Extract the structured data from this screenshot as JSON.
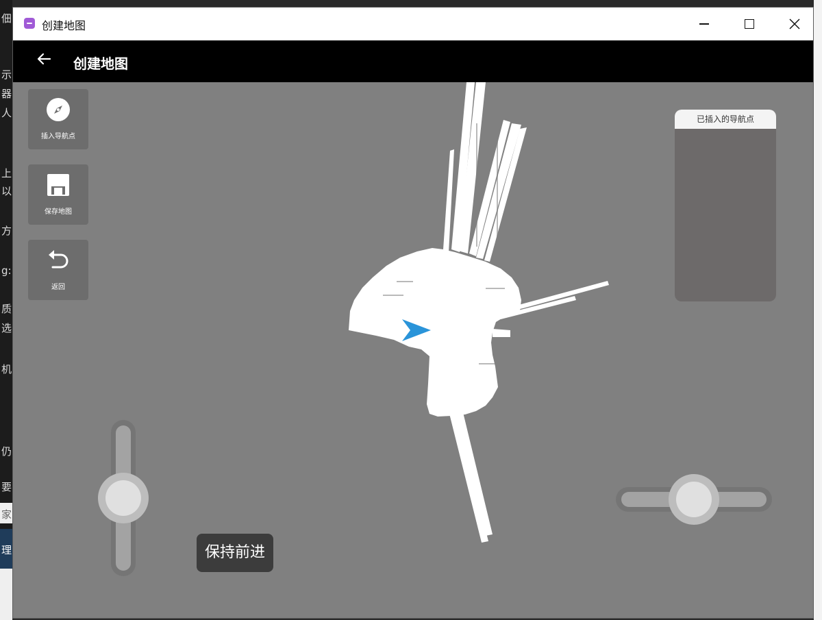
{
  "window": {
    "title": "创建地图",
    "icon": "app-icon",
    "controls": [
      "minimize-icon",
      "maximize-icon",
      "close-icon"
    ]
  },
  "header": {
    "title": "创建地图",
    "back_icon": "arrow-left-icon"
  },
  "toolbar": {
    "insert_waypoint": {
      "label": "插入导航点",
      "icon": "compass-icon"
    },
    "save_map": {
      "label": "保存地图",
      "icon": "floppy-disk-icon"
    },
    "go_back": {
      "label": "返回",
      "icon": "undo-arrow-icon"
    }
  },
  "nav_panel": {
    "title": "已插入的导航点",
    "items": []
  },
  "status": {
    "message": "保持前进"
  },
  "colors": {
    "map_background": "#808080",
    "free_space": "#ffffff",
    "robot_marker": "#2a94d9",
    "header_bg": "#000000"
  },
  "background_left_glyphs": [
    "佃",
    "示",
    "器",
    "人",
    "上",
    "以",
    "方",
    "g:",
    "质",
    "选",
    "机",
    "仍",
    "要",
    "家",
    "理"
  ]
}
